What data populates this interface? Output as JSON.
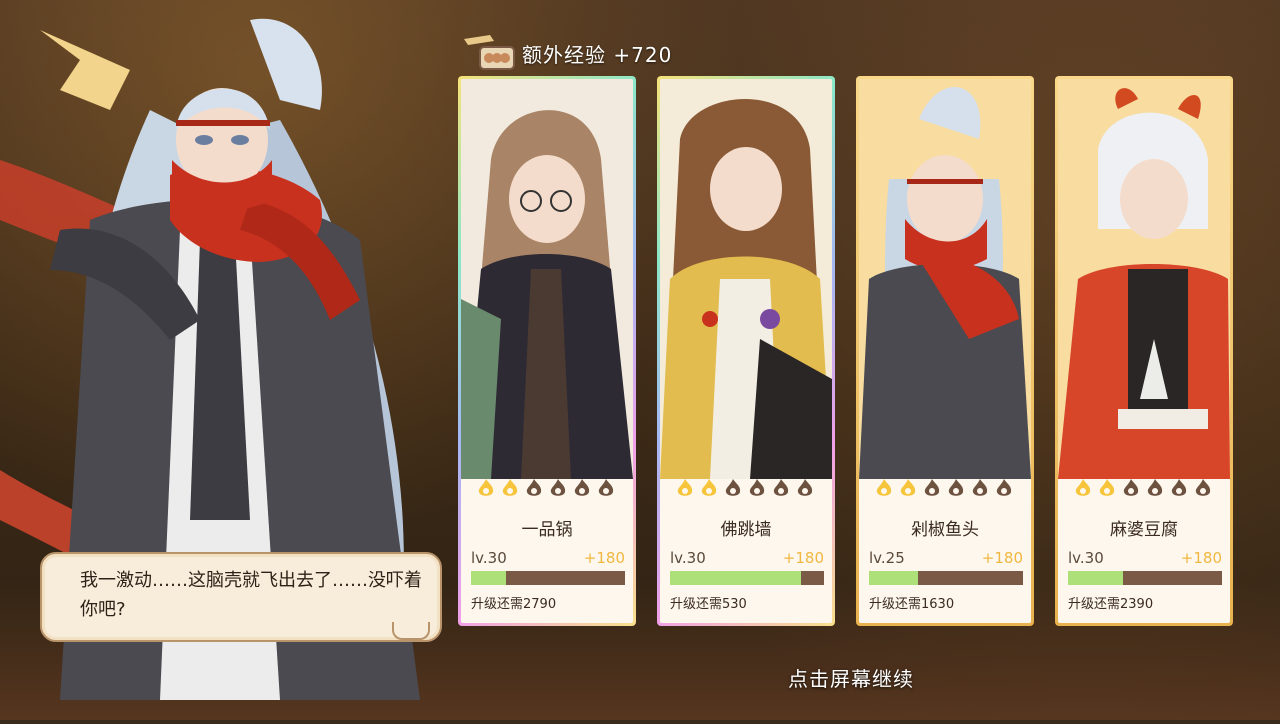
{
  "exp_banner": {
    "label": "额外经验 +720",
    "icon": "rice-bowl-icon"
  },
  "cards": [
    {
      "name": "一品锅",
      "level": "lv.30",
      "gain": "+180",
      "need": "升级还需2790",
      "progress": 0.23,
      "filled_flames": 2,
      "total_flames": 6,
      "frame": "rainbow"
    },
    {
      "name": "佛跳墙",
      "level": "lv.30",
      "gain": "+180",
      "need": "升级还需530",
      "progress": 0.85,
      "filled_flames": 2,
      "total_flames": 6,
      "frame": "rainbow"
    },
    {
      "name": "剁椒鱼头",
      "level": "lv.25",
      "gain": "+180",
      "need": "升级还需1630",
      "progress": 0.32,
      "filled_flames": 2,
      "total_flames": 6,
      "frame": "gold"
    },
    {
      "name": "麻婆豆腐",
      "level": "lv.30",
      "gain": "+180",
      "need": "升级还需2390",
      "progress": 0.36,
      "filled_flames": 2,
      "total_flames": 6,
      "frame": "gold"
    }
  ],
  "dialog": {
    "text": "我一激动……这脑壳就飞出去了……没吓着你吧?"
  },
  "continue_hint": "点击屏幕继续",
  "colors": {
    "flame_on": "#f6c53c",
    "flame_off": "#6e5240",
    "exp_fill": "#aee07a",
    "exp_track": "#7a5a45",
    "gain": "#f0b840"
  }
}
